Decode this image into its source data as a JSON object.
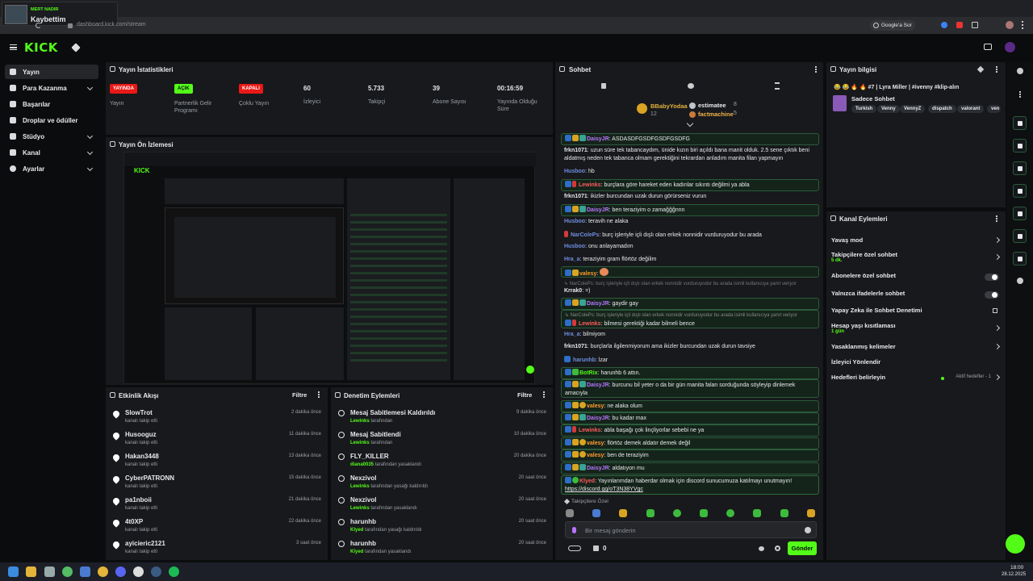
{
  "browser": {
    "tab_channel": "MERT NADIR",
    "tab_title": "Kaybettim",
    "url": "dashboard.kick.com/stream",
    "ask_google": "Google'a Sor"
  },
  "header": {
    "logo": "KICK"
  },
  "sidebar": {
    "items": [
      {
        "label": "Yayın"
      },
      {
        "label": "Para Kazanma"
      },
      {
        "label": "Başarılar"
      },
      {
        "label": "Droplar ve ödüller"
      },
      {
        "label": "Stüdyo"
      },
      {
        "label": "Kanal"
      },
      {
        "label": "Ayarlar"
      }
    ]
  },
  "stats": {
    "title": "Yayın İstatistikleri",
    "items": [
      {
        "value": "YAYINDA",
        "label": "Yayın"
      },
      {
        "value": "AÇIK",
        "label": "Partnerlik Gelir Programı"
      },
      {
        "value": "KAPALI",
        "label": "Çoklu Yayın"
      },
      {
        "value": "60",
        "label": "İzleyici"
      },
      {
        "value": "5.733",
        "label": "Takipçi"
      },
      {
        "value": "39",
        "label": "Abone Sayısı"
      },
      {
        "value": "00:16:59",
        "label": "Yayında Olduğu Süre"
      }
    ]
  },
  "preview": {
    "title": "Yayın Ön İzlemesi"
  },
  "events": {
    "title": "Etkinlik Akışı",
    "filter": "Filtre",
    "rows": [
      {
        "name": "SlowTrot",
        "sub": "kanalı takip etti",
        "time": "2 dakika önce"
      },
      {
        "name": "Husooguz",
        "sub": "kanalı takip etti",
        "time": "11 dakika önce"
      },
      {
        "name": "Hakan3448",
        "sub": "kanalı takip etti",
        "time": "13 dakika önce"
      },
      {
        "name": "CyberPATRONN",
        "sub": "kanalı takip etti",
        "time": "15 dakika önce"
      },
      {
        "name": "pa1nboii",
        "sub": "kanalı takip etti",
        "time": "21 dakika önce"
      },
      {
        "name": "4t0XP",
        "sub": "kanalı takip etti",
        "time": "22 dakika önce"
      },
      {
        "name": "ayicieric2121",
        "sub": "kanalı takip etti",
        "time": "3 saat önce"
      }
    ]
  },
  "moderation": {
    "title": "Denetim Eylemleri",
    "filter": "Filtre",
    "rows": [
      {
        "name": "Mesaj Sabitlemesi Kaldırıldı",
        "actor": "Lewinks",
        "rest": "tarafından",
        "time": "9 dakika önce"
      },
      {
        "name": "Mesaj Sabitlendi",
        "actor": "Lewinks",
        "rest": "tarafından",
        "time": "10 dakika önce"
      },
      {
        "name": "FLY_KILLER",
        "actor": "diana0035",
        "rest": "tarafından yasaklandı",
        "time": "20 dakika önce"
      },
      {
        "name": "Nexzivol",
        "actor": "Lewinks",
        "rest": "tarafından yasağı kaldırıldı",
        "time": "20 saat önce"
      },
      {
        "name": "Nexzivol",
        "actor": "Lewinks",
        "rest": "tarafından yasaklandı",
        "time": "20 saat önce"
      },
      {
        "name": "harunhb",
        "actor": "Klyed",
        "rest": "tarafından yasağı kaldırıldı",
        "time": "20 saat önce"
      },
      {
        "name": "harunhb",
        "actor": "Klyed",
        "rest": "tarafından yasaklandı",
        "time": "20 saat önce"
      }
    ]
  },
  "chat": {
    "title": "Sohbet",
    "leaderboard": [
      {
        "name": "BBabyYodaa",
        "count": "12"
      },
      {
        "name": "estimatee",
        "count": "8"
      },
      {
        "name": "factmachine",
        "count": "5"
      }
    ],
    "messages": [
      {
        "user": "DaisyJR",
        "text": "ASDASDFGSDFGSDFGSDFG"
      },
      {
        "user": "frkn1071",
        "text": "uzun süre tek tabancaydım, ünide kızın biri açıldı bana manit olduk. 2.5 sene çıktık beni aldatmış neden tek tabanca olmam gerektiğini tekrardan anladım manita filan yapmayın"
      },
      {
        "user": "Husboo",
        "text": "hb"
      },
      {
        "user": "Lewinks",
        "text": "burçlara göre hareket eden kadınlar sıkıntı değilmi ya abla"
      },
      {
        "user": "frkn1071",
        "text": "ikizler burcundan uzak durun görürseniz vurun"
      },
      {
        "user": "DaisyJR",
        "text": "ben teraziyim o zamağğğnnn"
      },
      {
        "user": "Husboo",
        "text": "teravih ne alaka"
      },
      {
        "user": "NarColePs",
        "text": "burç işleriyle içli dışlı olan erkek nonnidir vurduruyodur bu arada"
      },
      {
        "user": "Husboo",
        "text": "onu anlayamadım"
      },
      {
        "user": "Hra_a",
        "text": "teraziyim gram flörtöz değilim"
      },
      {
        "user": "valesy",
        "text": ""
      },
      {
        "user": "NarColePs",
        "text": "burç işleriyle içli dışlı olan erkek nonnidir vurduruyodur bu arada isimli kullanıcıya yanıt veriyor"
      },
      {
        "user": "Krrak0",
        "text": "=)"
      },
      {
        "user": "DaisyJR",
        "text": "gaydir gay"
      },
      {
        "user": "NarColePs",
        "text": "burç işleriyle içli dışlı olan erkek nonnidir vurduruyodur bu arada isimli kullanıcıya yanıt veriyor"
      },
      {
        "user": "Lewinks",
        "text": "bilmesi gerektiği kadar bilmeli bence"
      },
      {
        "user": "Hra_a",
        "text": "bilmiyom"
      },
      {
        "user": "frkn1071",
        "text": "burçlarla ilgilenmiyorum ama ikizler burcundan uzak durun tavsiye"
      },
      {
        "user": "harunhb",
        "text": "lzar"
      },
      {
        "user": "BotRix",
        "text": "harunhb 6 attın."
      },
      {
        "user": "DaisyJR",
        "text": "burcunu bil yeter o da bir gün manita falan sorduğunda söyleyip dinlemek amacıyla"
      },
      {
        "user": "valesy",
        "text": "ne alaka olum"
      },
      {
        "user": "DaisyJR",
        "text": "bu kadar max"
      },
      {
        "user": "Lewinks",
        "text": "abla başağı çok linçliyorlar sebebi ne ya"
      },
      {
        "user": "valesy",
        "text": "flörtöz demek aldatır demek değil"
      },
      {
        "user": "valesy",
        "text": "ben de teraziyim"
      },
      {
        "user": "DaisyJR",
        "text": "aldatıyon mu"
      },
      {
        "user": "Klyed",
        "text": "Yayınlarımdan haberdar olmak için discord sunucumuza katılmayı unutmayın!"
      },
      {
        "user": "link",
        "text": "https://discord.gg/oT3N38YVgc"
      }
    ],
    "followers_only": "Takipçilere Özel",
    "placeholder": "Bir mesaj gönderin",
    "points": "0",
    "send": "Gönder"
  },
  "stream_info": {
    "title": "Yayın bilgisi",
    "stream_title": "😂 😂 🔥 🔥 #7 | Lyra Miller | #ivenny #klip-alın",
    "category": "Sadece Sohbet",
    "tags": [
      "Turkish",
      "Venny",
      "VennyZ",
      "dispatch",
      "valorant",
      "ven"
    ]
  },
  "channel_actions": {
    "title": "Kanal Eylemleri",
    "rows": [
      {
        "label": "Yavaş mod",
        "sub": ""
      },
      {
        "label": "Takipçilere özel sohbet",
        "sub": "5 dk."
      },
      {
        "label": "Abonelere özel sohbet",
        "sub": ""
      },
      {
        "label": "Yalnızca ifadelerle sohbet",
        "sub": ""
      },
      {
        "label": "Yapay Zeka ile Sohbet Denetimi",
        "sub": ""
      },
      {
        "label": "Hesap yaşı kısıtlaması",
        "sub": "1 gün"
      },
      {
        "label": "Yasaklanmış kelimeler",
        "sub": ""
      },
      {
        "label": "İzleyici Yönlendir",
        "sub": ""
      },
      {
        "label": "Hedefleri belirleyin",
        "sub": "Aktif hedefler - 1"
      }
    ]
  },
  "taskbar": {
    "time": "18:00",
    "date": "28.12.2025"
  },
  "colors": {
    "accent": "#53fc18",
    "live": "#e91916",
    "panel": "#18191c",
    "bg": "#0b0c0e"
  }
}
